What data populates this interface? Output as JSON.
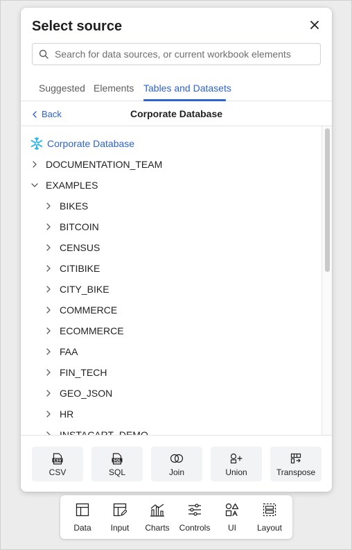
{
  "dialog": {
    "title": "Select source",
    "search_placeholder": "Search for data sources, or current workbook elements"
  },
  "tabs": [
    {
      "label": "Suggested",
      "active": false
    },
    {
      "label": "Elements",
      "active": false
    },
    {
      "label": "Tables and Datasets",
      "active": true
    }
  ],
  "subheader": {
    "back_label": "Back",
    "title": "Corporate Database"
  },
  "tree": {
    "root": "Corporate Database",
    "items": [
      {
        "label": "DOCUMENTATION_TEAM",
        "level": 1,
        "expanded": false
      },
      {
        "label": "EXAMPLES",
        "level": 1,
        "expanded": true
      },
      {
        "label": "BIKES",
        "level": 2,
        "expanded": false
      },
      {
        "label": "BITCOIN",
        "level": 2,
        "expanded": false
      },
      {
        "label": "CENSUS",
        "level": 2,
        "expanded": false
      },
      {
        "label": "CITIBIKE",
        "level": 2,
        "expanded": false
      },
      {
        "label": "CITY_BIKE",
        "level": 2,
        "expanded": false
      },
      {
        "label": "COMMERCE",
        "level": 2,
        "expanded": false
      },
      {
        "label": "ECOMMERCE",
        "level": 2,
        "expanded": false
      },
      {
        "label": "FAA",
        "level": 2,
        "expanded": false
      },
      {
        "label": "FIN_TECH",
        "level": 2,
        "expanded": false
      },
      {
        "label": "GEO_JSON",
        "level": 2,
        "expanded": false
      },
      {
        "label": "HR",
        "level": 2,
        "expanded": false
      },
      {
        "label": "INSTACART_DEMO",
        "level": 2,
        "expanded": false
      }
    ]
  },
  "source_buttons": [
    {
      "label": "CSV",
      "icon": "csv-file-icon"
    },
    {
      "label": "SQL",
      "icon": "sql-file-icon"
    },
    {
      "label": "Join",
      "icon": "join-icon"
    },
    {
      "label": "Union",
      "icon": "union-icon"
    },
    {
      "label": "Transpose",
      "icon": "transpose-icon"
    }
  ],
  "toolbar": [
    {
      "label": "Data",
      "icon": "table-icon"
    },
    {
      "label": "Input",
      "icon": "input-table-icon"
    },
    {
      "label": "Charts",
      "icon": "chart-icon"
    },
    {
      "label": "Controls",
      "icon": "sliders-icon"
    },
    {
      "label": "UI",
      "icon": "shapes-icon"
    },
    {
      "label": "Layout",
      "icon": "layout-icon"
    }
  ],
  "colors": {
    "accent": "#2d62d1",
    "snowflake": "#29b5e8",
    "text": "#1f1f1f",
    "muted": "#5c5c5c"
  }
}
